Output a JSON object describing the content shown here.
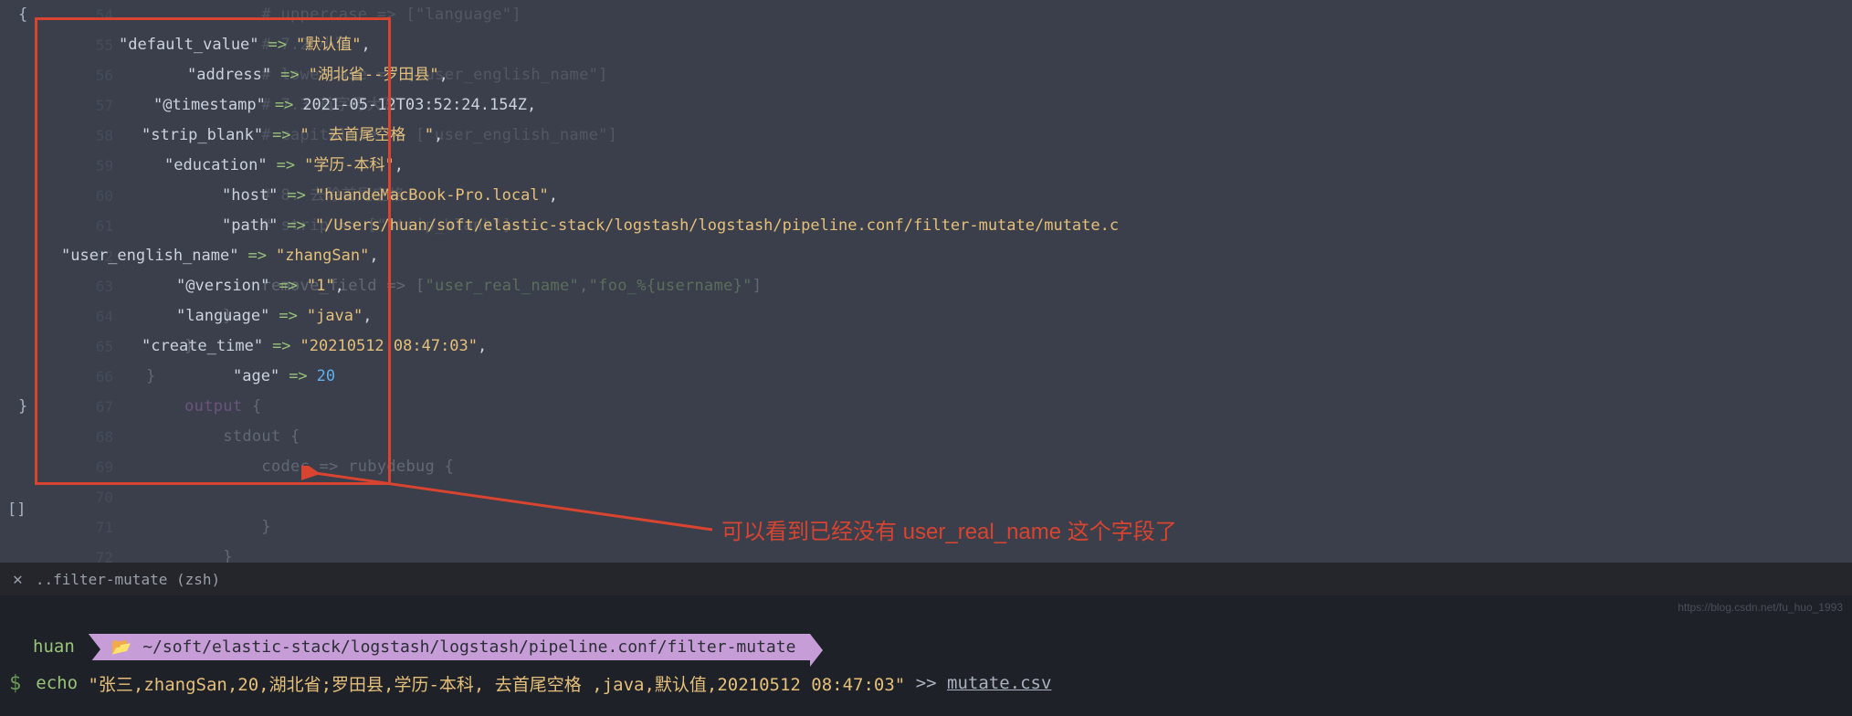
{
  "bg_lines": [
    {
      "n": "54",
      "indent": "            ",
      "text": "# uppercase => [\"language\"]",
      "cls": "c-comment"
    },
    {
      "n": "55",
      "indent": "            ",
      "text": "# 7.2 小写",
      "cls": "c-comment"
    },
    {
      "n": "56",
      "indent": "            ",
      "text": "# lowercase => [\"user_english_name\"]",
      "cls": "c-comment"
    },
    {
      "n": "57",
      "indent": "            ",
      "text": "# 7.3 首字母大写",
      "cls": "c-comment"
    },
    {
      "n": "58",
      "indent": "            ",
      "text": "# capitalize => [\"user_english_name\"]",
      "cls": "c-comment"
    },
    {
      "n": "59",
      "indent": "",
      "text": "",
      "cls": "c-plain"
    },
    {
      "n": "60",
      "indent": "            ",
      "text": "# 8. 去除首尾空格",
      "cls": "c-comment"
    },
    {
      "n": "61",
      "indent": "            ",
      "text": "# strip => [\"strip_blank\"]",
      "cls": "c-comment"
    },
    {
      "n": "62",
      "indent": "",
      "text": "",
      "cls": "c-plain"
    },
    {
      "n": "63",
      "indent": "            ",
      "parts": [
        {
          "t": "remove_field => [",
          "c": "c-plain"
        },
        {
          "t": "\"user_real_name\"",
          "c": "c-str"
        },
        {
          "t": ",",
          "c": "c-plain"
        },
        {
          "t": "\"foo_%{username}\"",
          "c": "c-str"
        },
        {
          "t": "]",
          "c": "c-plain"
        }
      ]
    },
    {
      "n": "64",
      "indent": "        ",
      "text": "}",
      "cls": "c-plain"
    },
    {
      "n": "65",
      "indent": "    ",
      "text": "}",
      "cls": "c-plain"
    },
    {
      "n": "66",
      "indent": "",
      "text": "}",
      "cls": "c-plain"
    },
    {
      "n": "67",
      "indent": "    ",
      "parts": [
        {
          "t": "output ",
          "c": "c-kw"
        },
        {
          "t": "{",
          "c": "c-plain"
        }
      ]
    },
    {
      "n": "68",
      "indent": "        ",
      "parts": [
        {
          "t": "stdout ",
          "c": "c-plain"
        },
        {
          "t": "{",
          "c": "c-plain"
        }
      ]
    },
    {
      "n": "69",
      "indent": "            ",
      "parts": [
        {
          "t": "codec => rubydebug ",
          "c": "c-plain"
        },
        {
          "t": "{",
          "c": "c-plain"
        }
      ]
    },
    {
      "n": "70",
      "indent": "",
      "text": "",
      "cls": "c-plain"
    },
    {
      "n": "71",
      "indent": "            ",
      "text": "}",
      "cls": "c-plain"
    },
    {
      "n": "72",
      "indent": "        ",
      "text": "}",
      "cls": "c-plain"
    }
  ],
  "fg_open_brace": "{",
  "fg_lines": [
    {
      "pad": 130,
      "key": "\"default_value\"",
      "arrow": "=>",
      "val": "\"默认值\"",
      "comma": ",",
      "type": "str"
    },
    {
      "pad": 205,
      "key": "\"address\"",
      "arrow": "=>",
      "val": "\"湖北省--罗田县\"",
      "comma": ",",
      "type": "str"
    },
    {
      "pad": 168,
      "key": "\"@timestamp\"",
      "arrow": "=>",
      "val": "2021-05-12T03:52:24.154Z",
      "comma": ",",
      "type": "plain"
    },
    {
      "pad": 155,
      "key": "\"strip_blank\"",
      "arrow": "=>",
      "val": "\"  去首尾空格  \"",
      "comma": ",",
      "type": "str"
    },
    {
      "pad": 180,
      "key": "\"education\"",
      "arrow": "=>",
      "val": "\"学历-本科\"",
      "comma": ",",
      "type": "str"
    },
    {
      "pad": 243,
      "key": "\"host\"",
      "arrow": "=>",
      "val": "\"huandeMacBook-Pro.local\"",
      "comma": ",",
      "type": "str"
    },
    {
      "pad": 243,
      "key": "\"path\"",
      "arrow": "=>",
      "val": "\"/Users/huan/soft/elastic-stack/logstash/logstash/pipeline.conf/filter-mutate/mutate.c",
      "comma": "",
      "type": "str"
    },
    {
      "pad": 67,
      "key": "\"user_english_name\"",
      "arrow": "=>",
      "val": "\"zhangSan\"",
      "comma": ",",
      "type": "str"
    },
    {
      "pad": 193,
      "key": "\"@version\"",
      "arrow": "=>",
      "val": "\"1\"",
      "comma": ",",
      "type": "str"
    },
    {
      "pad": 193,
      "key": "\"language\"",
      "arrow": "=>",
      "val": "\"java\"",
      "comma": ",",
      "type": "str"
    },
    {
      "pad": 155,
      "key": "\"create_time\"",
      "arrow": "=>",
      "val": "\"20210512 08:47:03\"",
      "comma": ",",
      "type": "str"
    },
    {
      "pad": 255,
      "key": "\"age\"",
      "arrow": "=>",
      "val": "20",
      "comma": "",
      "type": "num"
    }
  ],
  "fg_close_brace": "}",
  "annotation": "可以看到已经没有 user_real_name 这个字段了",
  "tab": {
    "close": "✕",
    "title": "..filter-mutate (zsh)"
  },
  "prompt": {
    "apple": "",
    "user": "huan",
    "folder_icon": "📂",
    "path": "~/soft/elastic-stack/logstash/logstash/pipeline.conf/filter-mutate"
  },
  "command": {
    "dollar": "$",
    "echo": "echo",
    "string": "\"张三,zhangSan,20,湖北省;罗田县,学历-本科,  去首尾空格  ,java,默认值,20210512 08:47:03\"",
    "redirect": ">>",
    "file": "mutate.csv"
  },
  "watermark": "https://blog.csdn.net/fu_huo_1993"
}
